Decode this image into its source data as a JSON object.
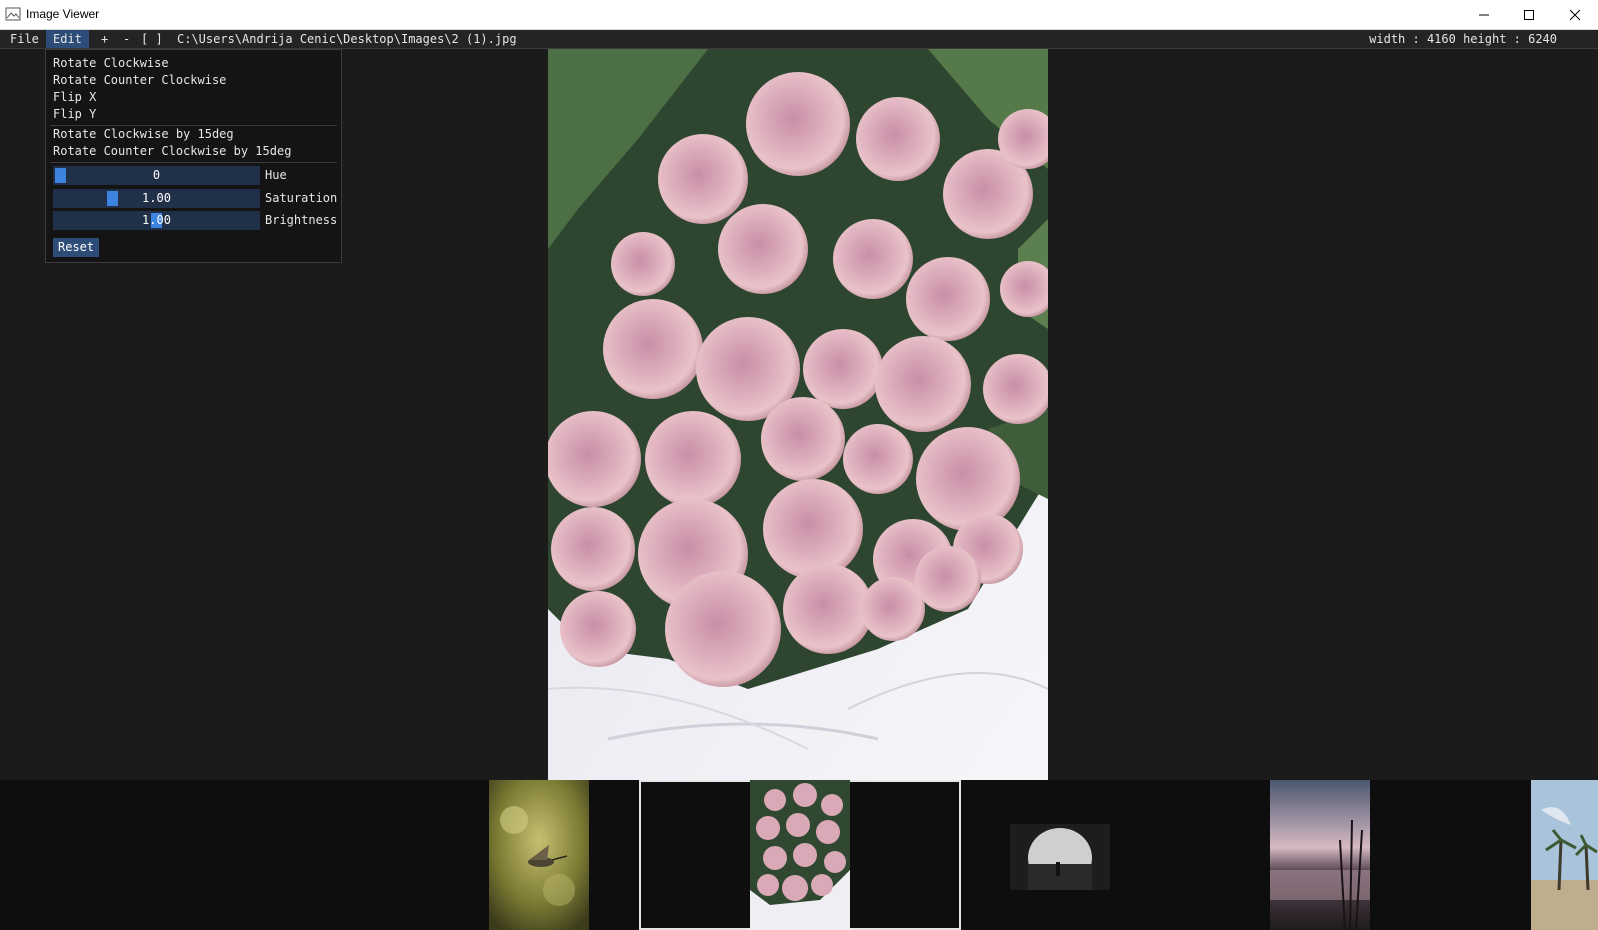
{
  "window": {
    "title": "Image Viewer",
    "icon": "image-icon",
    "controls": [
      "minimize-icon",
      "maximize-icon",
      "close-icon"
    ]
  },
  "menubar": {
    "file": "File",
    "edit": "Edit",
    "zoom_in": "+",
    "zoom_out": "-",
    "fit": "[ ]",
    "path": "C:\\Users\\Andrija Cenic\\Desktop\\Images\\2 (1).jpg",
    "dimensions": "width : 4160 height : 6240"
  },
  "edit_menu": {
    "rotate_cw": "Rotate Clockwise",
    "rotate_ccw": "Rotate Counter Clockwise",
    "flip_x": "Flip X",
    "flip_y": "Flip Y",
    "rotate_cw_15": "Rotate Clockwise by 15deg",
    "rotate_ccw_15": "Rotate Counter Clockwise by 15deg",
    "sliders": {
      "hue": {
        "label": "Hue",
        "value": "0",
        "position": 0.0
      },
      "saturation": {
        "label": "Saturation",
        "value": "1.00",
        "position": 0.27
      },
      "brightness": {
        "label": "Brightness",
        "value": "1.00",
        "position": 0.5
      }
    },
    "reset": "Reset"
  },
  "colors": {
    "accent": "#3d84e0",
    "menu_active": "#2d4d78",
    "slider_track": "#203048",
    "background": "#1b1b1b"
  },
  "thumbnails": [
    {
      "name": "thumbnail-hummingbird",
      "selected": false
    },
    {
      "name": "thumbnail-roses",
      "selected": true
    },
    {
      "name": "thumbnail-tunnel",
      "selected": false
    },
    {
      "name": "thumbnail-sunset-lake",
      "selected": false
    },
    {
      "name": "thumbnail-palm-trees",
      "selected": false
    }
  ]
}
